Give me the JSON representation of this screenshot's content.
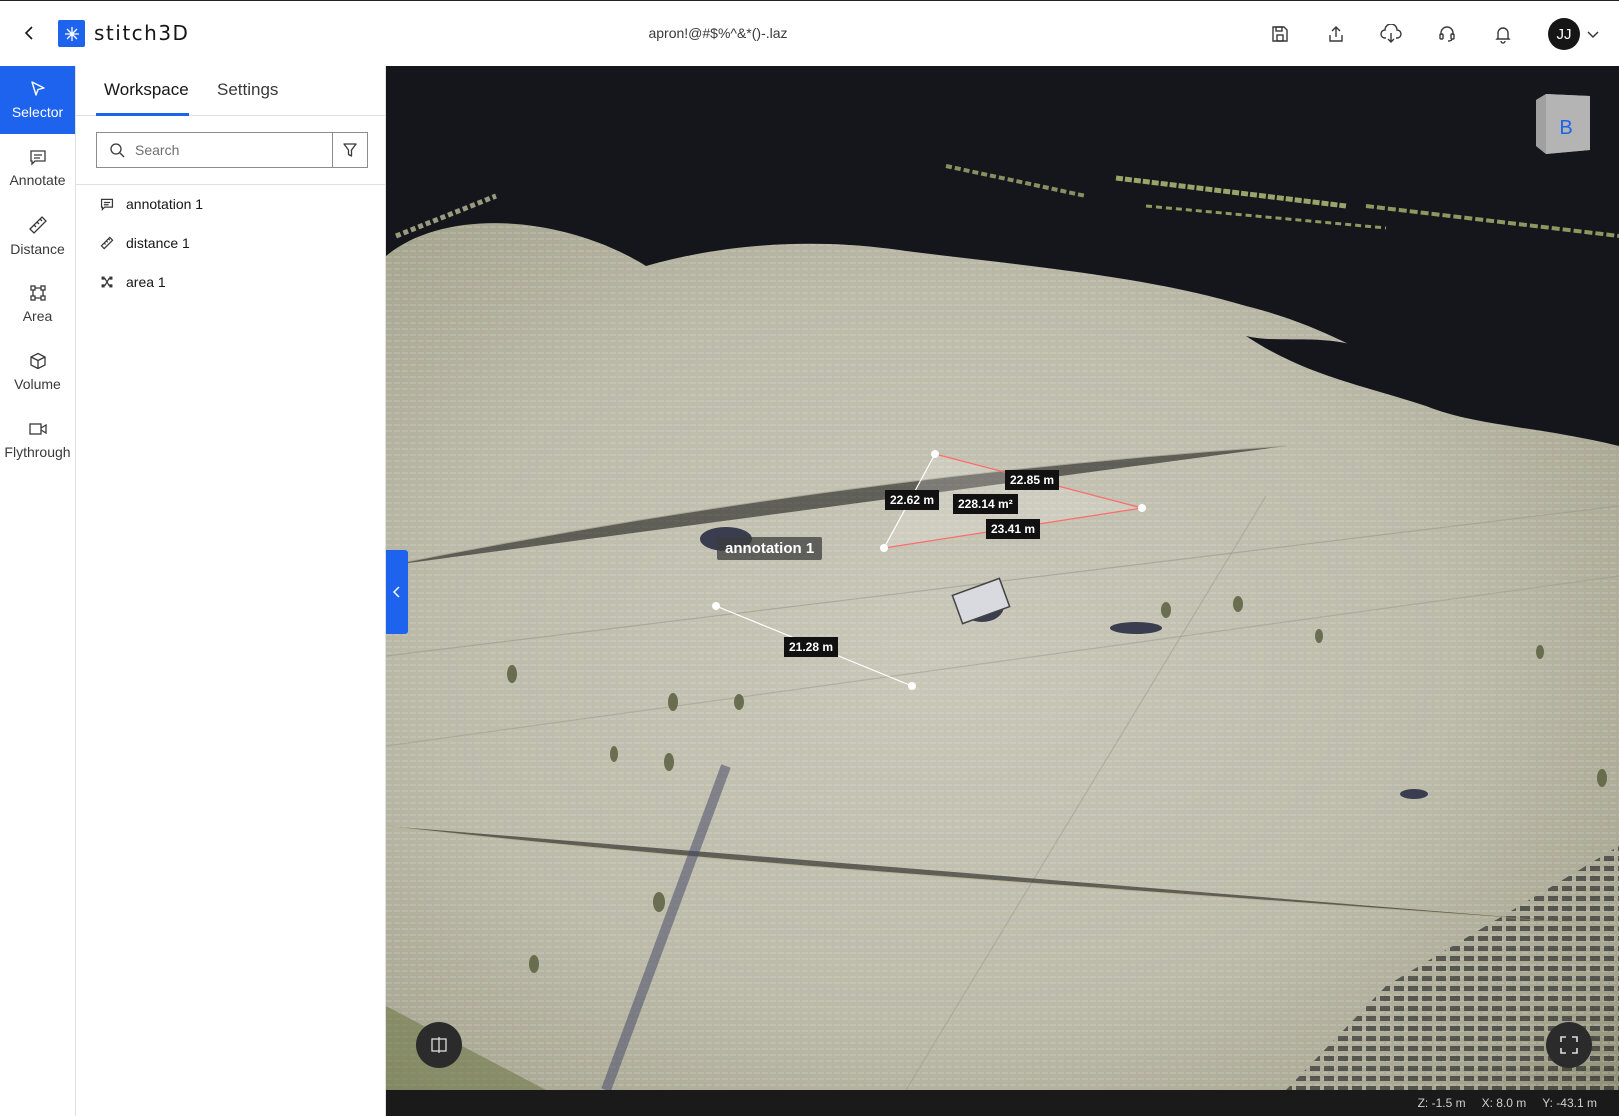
{
  "header": {
    "app_name": "stitch3D",
    "file_name": "apron!@#$%^&*()-.laz",
    "avatar_initials": "JJ"
  },
  "tools": [
    {
      "label": "Selector",
      "icon": "pointer-icon",
      "active": true
    },
    {
      "label": "Annotate",
      "icon": "comment-icon",
      "active": false
    },
    {
      "label": "Distance",
      "icon": "ruler-icon",
      "active": false
    },
    {
      "label": "Area",
      "icon": "area-icon",
      "active": false
    },
    {
      "label": "Volume",
      "icon": "cube-icon",
      "active": false
    },
    {
      "label": "Flythrough",
      "icon": "video-icon",
      "active": false
    }
  ],
  "panel": {
    "tabs": [
      "Workspace",
      "Settings"
    ],
    "active_tab": "Workspace",
    "search_placeholder": "Search",
    "items": [
      {
        "label": "annotation 1",
        "icon": "comment-icon"
      },
      {
        "label": "distance 1",
        "icon": "ruler-icon"
      },
      {
        "label": "area 1",
        "icon": "area-icon"
      }
    ]
  },
  "viewport": {
    "view_cube_face": "B",
    "annotation_label": "annotation 1",
    "area_measure": {
      "side_a": "22.62 m",
      "side_b": "22.85 m",
      "side_c": "23.41 m",
      "area": "228.14 m²"
    },
    "distance_measure": "21.28 m",
    "coords": {
      "z": "Z: -1.5 m",
      "x": "X: 8.0 m",
      "y": "Y: -43.1 m"
    }
  },
  "colors": {
    "accent": "#1d63ed",
    "area_line": "#ff6b6b",
    "distance_line": "#ffffff"
  }
}
